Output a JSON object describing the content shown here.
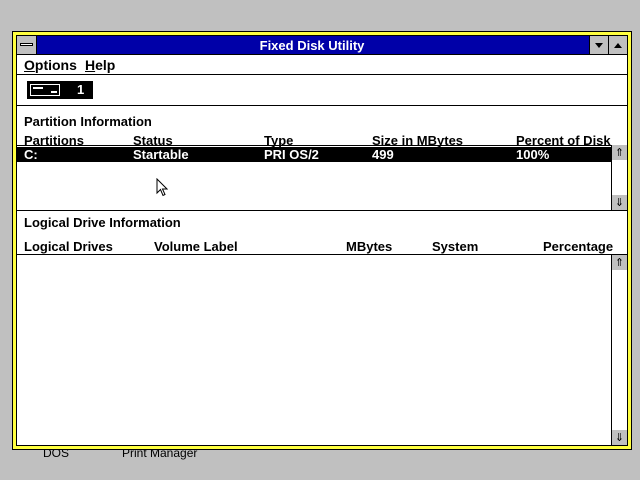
{
  "window": {
    "title": "Fixed Disk Utility"
  },
  "menubar": {
    "options": {
      "mnemonic": "O",
      "rest": "ptions"
    },
    "help": {
      "mnemonic": "H",
      "rest": "elp"
    }
  },
  "toolbar": {
    "disk_number": "1",
    "icon": "fixed-disk-icon"
  },
  "partition_info": {
    "title": "Partition Information",
    "columns": {
      "partitions": "Partitions",
      "status": "Status",
      "type": "Type",
      "size": "Size in MBytes",
      "percent": "Percent of Disk"
    },
    "rows": [
      {
        "partition": "C:",
        "status": "Startable",
        "type": "PRI OS/2",
        "size": "499",
        "percent": "100%"
      }
    ]
  },
  "logical_drive_info": {
    "title": "Logical Drive Information",
    "columns": {
      "drives": "Logical Drives",
      "label": "Volume Label",
      "mbytes": "MBytes",
      "system": "System",
      "percentage": "Percentage"
    },
    "rows": []
  },
  "desktop": {
    "labels": [
      "DOS",
      "Print Manager"
    ]
  },
  "colors": {
    "titlebar": "#0000a8",
    "window_frame": "#ffff40",
    "desktop": "#c0c0c0",
    "selection": "#000000"
  }
}
